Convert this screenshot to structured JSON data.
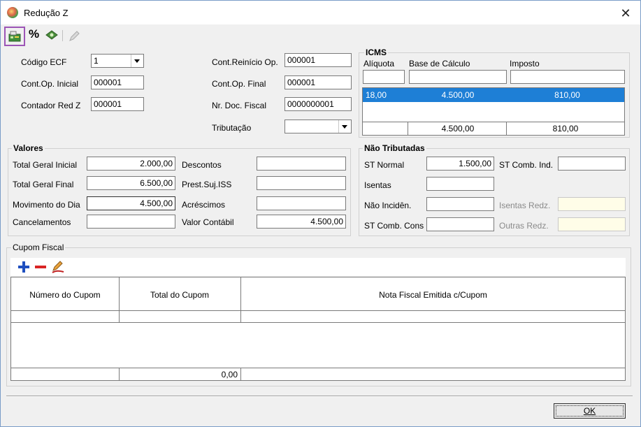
{
  "window": {
    "title": "Redução Z",
    "close": "✕"
  },
  "toolbar": {
    "icons": [
      "cash-register-icon",
      "percent-icon",
      "money-icon",
      "pencil-icon"
    ],
    "percent": "%"
  },
  "header_fields": {
    "codigo_ecf": {
      "label": "Código ECF",
      "value": "1"
    },
    "cont_op_inicial": {
      "label": "Cont.Op. Inicial",
      "value": "000001"
    },
    "contador_red_z": {
      "label": "Contador Red Z",
      "value": "000001"
    },
    "cont_reinicio": {
      "label": "Cont.Reinício Op.",
      "value": "000001"
    },
    "cont_op_final": {
      "label": "Cont.Op. Final",
      "value": "000001"
    },
    "nr_doc_fiscal": {
      "label": "Nr. Doc. Fiscal",
      "value": "0000000001"
    },
    "tributacao": {
      "label": "Tributação",
      "value": ""
    }
  },
  "icms": {
    "title": "ICMS",
    "col_aliquota": "Alíquota",
    "col_base": "Base de Cálculo",
    "col_imposto": "Imposto",
    "row": {
      "aliquota": "18,00",
      "base": "4.500,00",
      "imposto": "810,00"
    },
    "total": {
      "base": "4.500,00",
      "imposto": "810,00"
    }
  },
  "valores": {
    "title": "Valores",
    "total_geral_inicial": {
      "label": "Total Geral Inicial",
      "value": "2.000,00"
    },
    "total_geral_final": {
      "label": "Total Geral Final",
      "value": "6.500,00"
    },
    "movimento_dia": {
      "label": "Movimento do Dia",
      "value": "4.500,00"
    },
    "cancelamentos": {
      "label": "Cancelamentos",
      "value": ""
    },
    "descontos": {
      "label": "Descontos",
      "value": ""
    },
    "prest_suj_iss": {
      "label": "Prest.Suj.ISS",
      "value": ""
    },
    "acrescimos": {
      "label": "Acréscimos",
      "value": ""
    },
    "valor_contabil": {
      "label": "Valor Contábil",
      "value": "4.500,00"
    }
  },
  "nao_tributadas": {
    "title": "Não Tributadas",
    "st_normal": {
      "label": "ST Normal",
      "value": "1.500,00"
    },
    "isentas": {
      "label": "Isentas",
      "value": ""
    },
    "nao_incid": {
      "label": "Não Incidên.",
      "value": ""
    },
    "st_comb_cons": {
      "label": "ST Comb. Cons",
      "value": ""
    },
    "st_comb_ind": {
      "label": "ST Comb. Ind.",
      "value": ""
    },
    "isentas_redz": {
      "label": "Isentas Redz.",
      "value": ""
    },
    "outras_redz": {
      "label": "Outras Redz.",
      "value": ""
    }
  },
  "cupom": {
    "title": "Cupom Fiscal",
    "col_numero": "Número do Cupom",
    "col_total": "Total do Cupom",
    "col_nota": "Nota Fiscal Emitida c/Cupom",
    "footer_total": "0,00",
    "icons": [
      "add-icon",
      "remove-icon",
      "edit-icon"
    ]
  },
  "ok_label": "OK",
  "colors": {
    "selection": "#1e7fd6",
    "highlight_border": "#9c55b6",
    "disabled_field": "#fffde8"
  }
}
